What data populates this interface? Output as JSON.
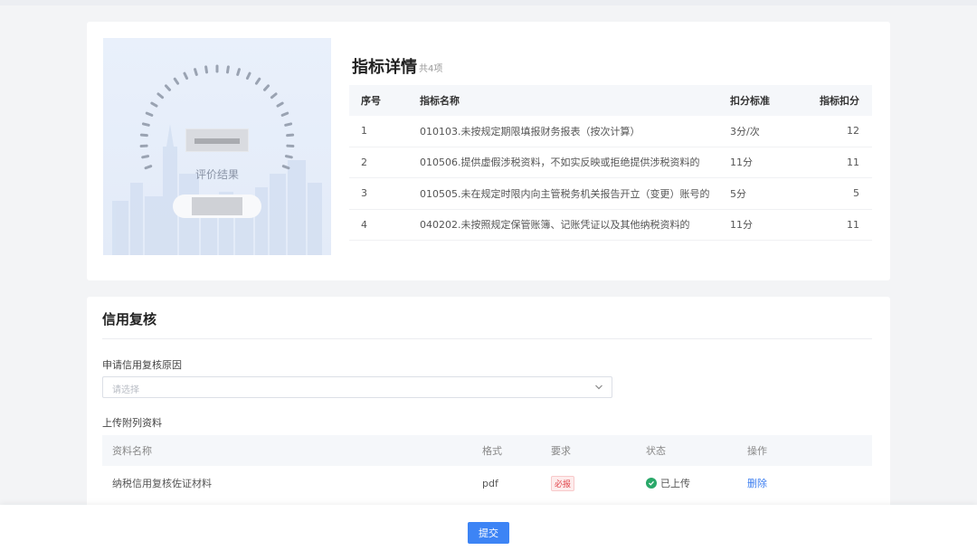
{
  "result_panel": {
    "label": "评价结果"
  },
  "indicator_detail": {
    "title": "指标详情",
    "count": "共4项",
    "columns": [
      "序号",
      "指标名称",
      "扣分标准",
      "指标扣分"
    ],
    "rows": [
      [
        "1",
        "010103.未按规定期限填报财务报表（按次计算）",
        "3分/次",
        "12"
      ],
      [
        "2",
        "010506.提供虚假涉税资料，不如实反映或拒绝提供涉税资料的",
        "11分",
        "11"
      ],
      [
        "3",
        "010505.未在规定时限内向主管税务机关报告开立（变更）账号的",
        "5分",
        "5"
      ],
      [
        "4",
        "040202.未按照规定保管账簿、记账凭证以及其他纳税资料的",
        "11分",
        "11"
      ]
    ]
  },
  "credit_review": {
    "title": "信用复核",
    "reason_label": "申请信用复核原因",
    "reason_placeholder": "请选择",
    "upload_label": "上传附列资料",
    "columns": [
      "资料名称",
      "格式",
      "要求",
      "状态",
      "操作"
    ],
    "files": [
      {
        "name": "纳税信用复核佐证材料",
        "format": "pdf",
        "requirement": "必报",
        "status": "已上传",
        "action": "删除"
      }
    ]
  },
  "footer": {
    "submit_label": "提交"
  },
  "colors": {
    "primary": "#3d84f5",
    "success": "#29a869",
    "required": "#e0444a"
  }
}
